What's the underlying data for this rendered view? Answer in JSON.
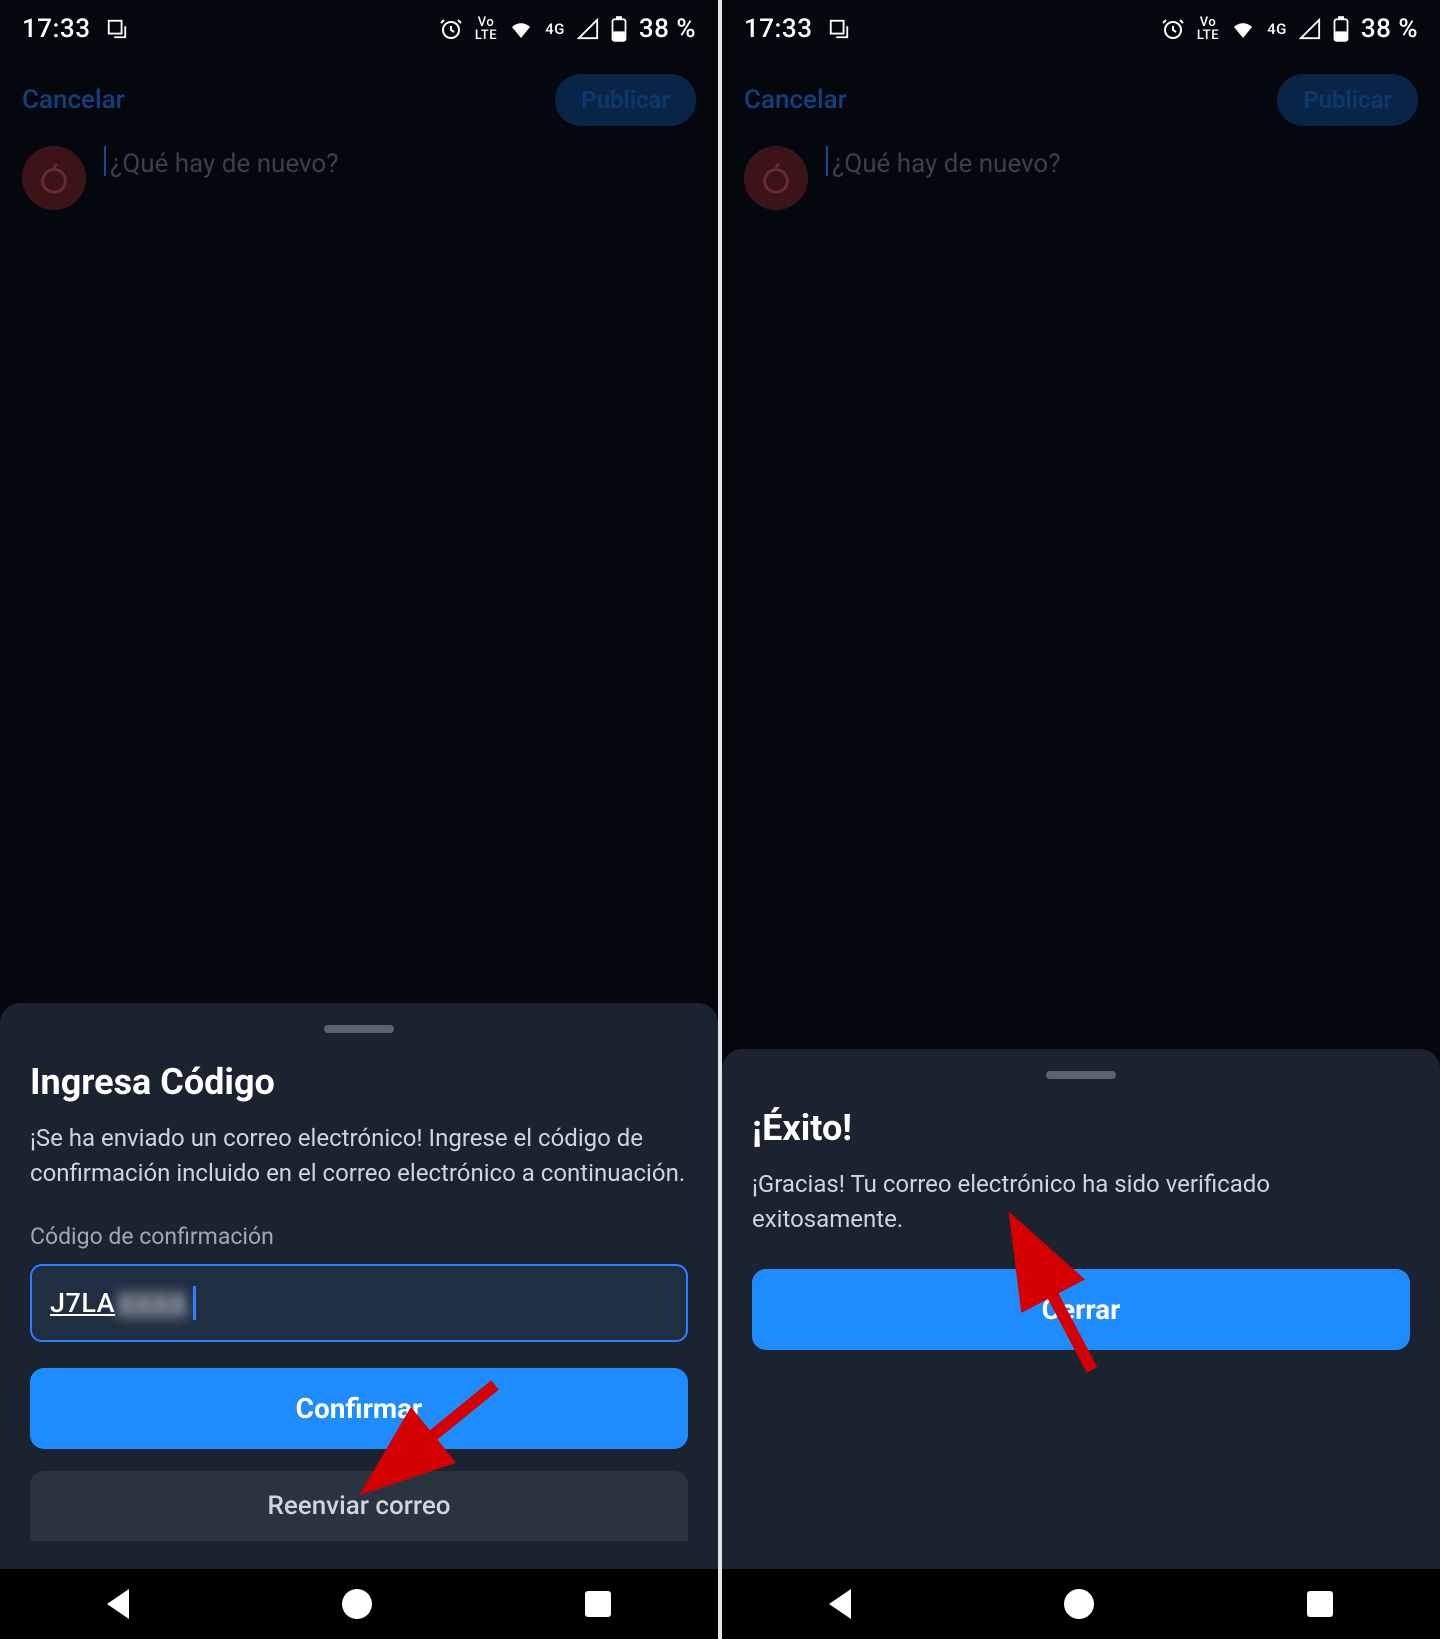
{
  "status": {
    "time": "17:33",
    "battery": "38 %",
    "network_label": "4G",
    "volte_label": "VoLTE"
  },
  "header": {
    "cancel": "Cancelar",
    "publish": "Publicar"
  },
  "compose": {
    "placeholder": "¿Qué hay de nuevo?"
  },
  "sheet_left": {
    "title": "Ingresa Código",
    "body": "¡Se ha enviado un correo electrónico! Ingrese el código de confirmación incluido en el correo electrónico a continuación.",
    "field_label": "Código de confirmación",
    "code_prefix": "J7LA",
    "code_hidden": "XXXX",
    "confirm": "Confirmar",
    "resend": "Reenviar correo"
  },
  "sheet_right": {
    "title": "¡Éxito!",
    "body": "¡Gracias! Tu correo electrónico ha sido verificado exitosamente.",
    "close": "Cerrar"
  }
}
